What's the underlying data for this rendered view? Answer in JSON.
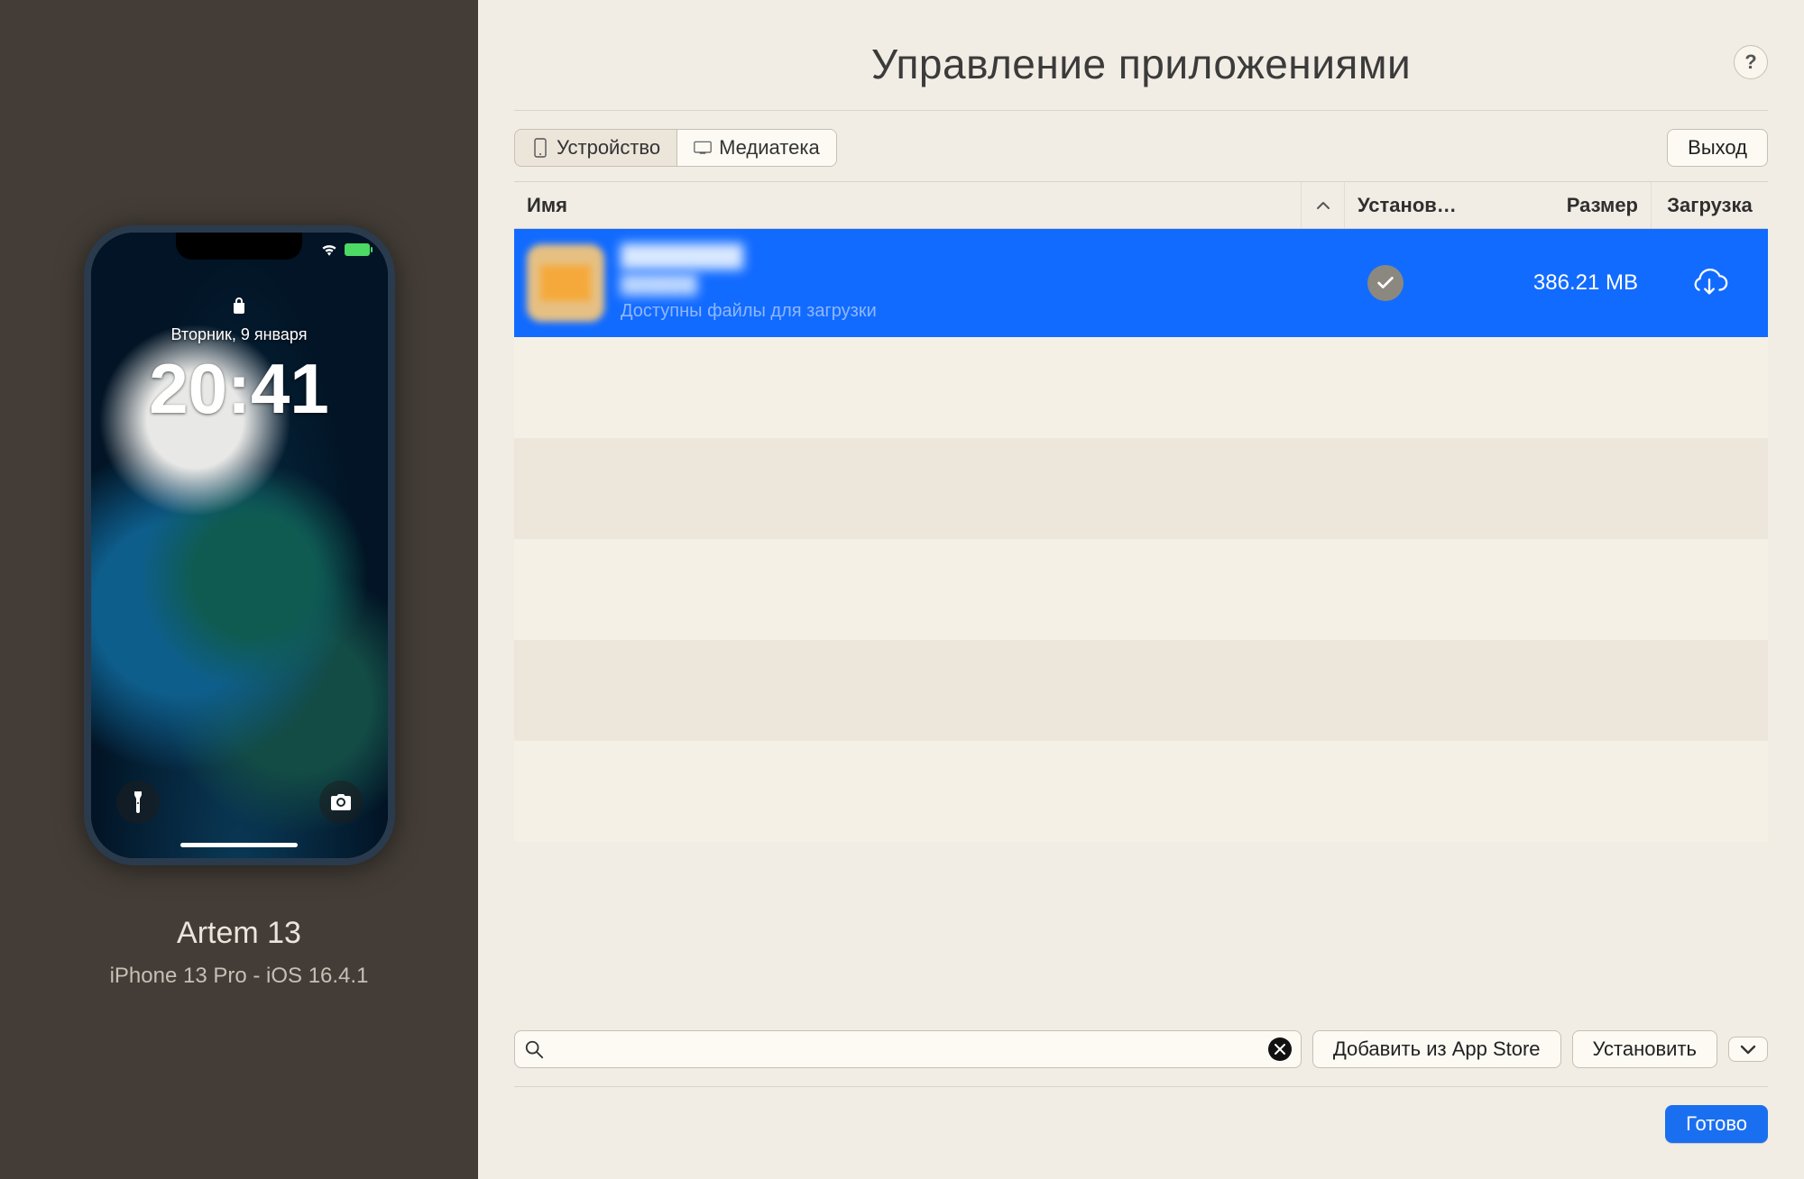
{
  "sidebar": {
    "device_name": "Artem 13",
    "device_meta": "iPhone 13 Pro - iOS 16.4.1",
    "lockscreen": {
      "date": "Вторник, 9 января",
      "time": "20:41"
    }
  },
  "header": {
    "title": "Управление приложениями",
    "help_label": "?"
  },
  "toolbar": {
    "tab_device": "Устройство",
    "tab_library": "Медиатека",
    "exit_label": "Выход"
  },
  "table": {
    "columns": {
      "name": "Имя",
      "installed": "Установ…",
      "size": "Размер",
      "download": "Загрузка"
    },
    "rows": [
      {
        "app_name": "████████",
        "app_vendor": "██████",
        "note": "Доступны файлы для загрузки",
        "installed": true,
        "size": "386.21 MB"
      }
    ]
  },
  "footer": {
    "search_placeholder": "",
    "add_from_appstore": "Добавить из App Store",
    "install": "Установить",
    "chevron": "⌄",
    "done": "Готово"
  }
}
